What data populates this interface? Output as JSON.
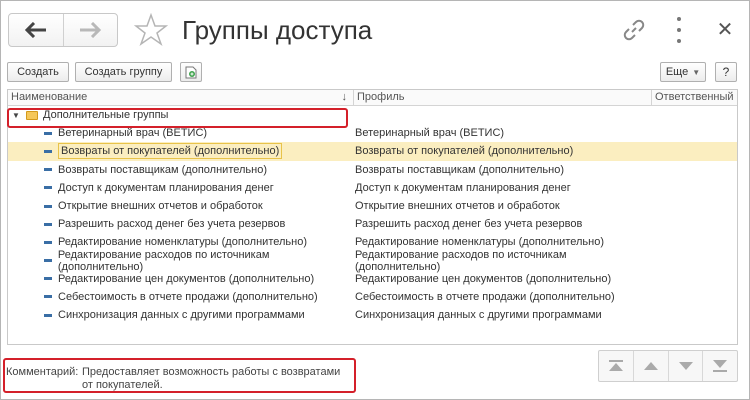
{
  "window": {
    "title": "Группы доступа"
  },
  "toolbar": {
    "create_label": "Создать",
    "create_group_label": "Создать группу",
    "more_label": "Еще",
    "help_label": "?"
  },
  "table": {
    "columns": [
      "Наименование",
      "Профиль",
      "Ответственный"
    ],
    "sort_indicator": "↓",
    "group_row": {
      "label": "Дополнительные группы"
    },
    "rows": [
      {
        "name": "Ветеринарный врач (ВЕТИС)",
        "profile": "Ветеринарный врач (ВЕТИС)",
        "responsible": ""
      },
      {
        "name": "Возвраты от покупателей (дополнительно)",
        "profile": "Возвраты от покупателей (дополнительно)",
        "responsible": "",
        "selected": true
      },
      {
        "name": "Возвраты поставщикам (дополнительно)",
        "profile": "Возвраты поставщикам (дополнительно)",
        "responsible": ""
      },
      {
        "name": "Доступ к документам планирования денег",
        "profile": "Доступ к документам планирования денег",
        "responsible": ""
      },
      {
        "name": "Открытие внешних отчетов и обработок",
        "profile": "Открытие внешних отчетов и обработок",
        "responsible": ""
      },
      {
        "name": "Разрешить расход денег без учета резервов",
        "profile": "Разрешить расход денег без учета резервов",
        "responsible": ""
      },
      {
        "name": "Редактирование номенклатуры (дополнительно)",
        "profile": "Редактирование номенклатуры (дополнительно)",
        "responsible": ""
      },
      {
        "name": "Редактирование расходов по источникам (дополнительно)",
        "profile": "Редактирование расходов по источникам (дополнительно)",
        "responsible": ""
      },
      {
        "name": "Редактирование цен документов (дополнительно)",
        "profile": "Редактирование цен документов (дополнительно)",
        "responsible": ""
      },
      {
        "name": "Себестоимость в отчете продажи (дополнительно)",
        "profile": "Себестоимость в отчете продажи (дополнительно)",
        "responsible": ""
      },
      {
        "name": "Синхронизация данных с другими программами",
        "profile": "Синхронизация данных с другими программами",
        "responsible": ""
      }
    ]
  },
  "footer": {
    "comment_label": "Комментарий:",
    "comment_text": "Предоставляет возможность работы с возвратами от покупателей."
  },
  "icons": {
    "back": "arrow-left-icon",
    "forward": "arrow-right-icon",
    "favorite": "star-icon",
    "link": "link-icon",
    "more": "vertical-dots-icon",
    "close": "close-icon",
    "folder": "folder-icon",
    "document": "document-icon"
  },
  "colors": {
    "selected_row": "#fbeec0",
    "highlight_box": "#d4202a",
    "folder": "#f5c75a",
    "item_marker": "#3a6ea5"
  }
}
